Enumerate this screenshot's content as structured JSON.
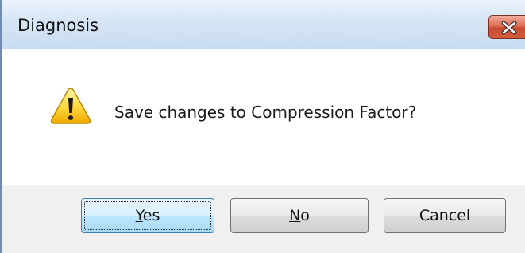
{
  "window": {
    "title": "Diagnosis"
  },
  "titlebar": {
    "close_icon": "close-icon"
  },
  "message": {
    "icon": "warning-icon",
    "text": "Save changes to Compression Factor?"
  },
  "buttons": {
    "yes": {
      "accel": "Y",
      "rest": "es"
    },
    "no": {
      "accel": "N",
      "rest": "o"
    },
    "cancel": {
      "label": "Cancel"
    }
  }
}
